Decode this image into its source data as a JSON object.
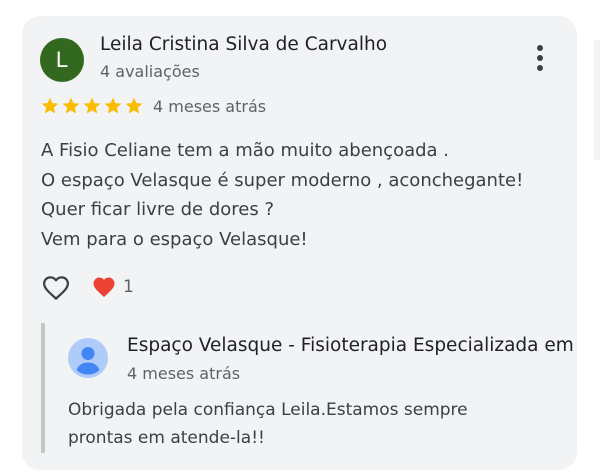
{
  "review": {
    "author_initial": "L",
    "author_name": "Leila Cristina Silva de Carvalho",
    "review_count": "4 avaliações",
    "rating": 5,
    "time": "4 meses atrás",
    "lines": [
      "A Fisio Celiane tem a mão muito abençoada .",
      "O espaço Velasque é super moderno , aconchegante!",
      "Quer ficar livre de dores ?",
      "Vem para o espaço Velasque!"
    ],
    "reaction_count": "1"
  },
  "reply": {
    "owner_name": "Espaço Velasque - Fisioterapia Especializada em Coluna",
    "time": "4 meses atrás",
    "lines": [
      "Obrigada pela confiança Leila.Estamos sempre",
      "prontas em atende-la!!"
    ]
  },
  "colors": {
    "star": "#fbbc04",
    "heart": "#ea4335",
    "avatar": "#33691e",
    "owner_avatar": "#aecbfa"
  },
  "icons": [
    "more-vert-icon",
    "star-icon",
    "heart-outline-icon",
    "heart-filled-icon",
    "account-circle-icon"
  ]
}
